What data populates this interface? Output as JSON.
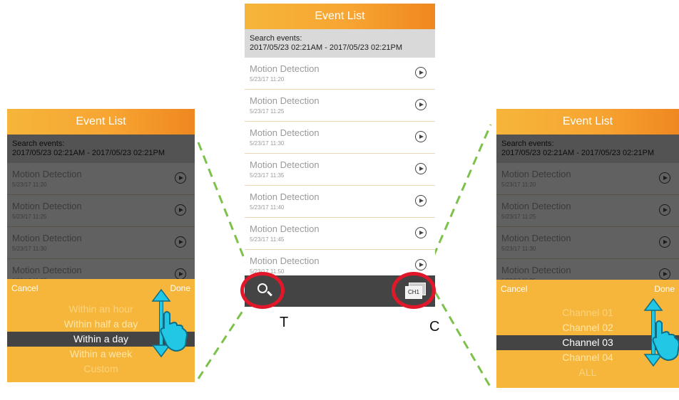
{
  "app_title": "Event List",
  "search": {
    "label": "Search events:",
    "range": "2017/05/23 02:21AM - 2017/05/23 02:21PM"
  },
  "events": [
    {
      "title": "Motion Detection",
      "time": "5/23/17 11:20"
    },
    {
      "title": "Motion Detection",
      "time": "5/23/17 11:25"
    },
    {
      "title": "Motion Detection",
      "time": "5/23/17 11:30"
    },
    {
      "title": "Motion Detection",
      "time": "5/23/17 11:35"
    },
    {
      "title": "Motion Detection",
      "time": "5/23/17 11:40"
    },
    {
      "title": "Motion Detection",
      "time": "5/23/17 11:45"
    },
    {
      "title": "Motion Detection",
      "time": "5/23/17 11:50"
    }
  ],
  "toolbar": {
    "search_icon": "search-icon",
    "channel_badge": "CH1"
  },
  "time_picker": {
    "cancel": "Cancel",
    "done": "Done",
    "options": [
      "Within an hour",
      "Within half a day",
      "Within a day",
      "Within a week",
      "Custom"
    ],
    "selected_index": 2
  },
  "channel_picker": {
    "cancel": "Cancel",
    "done": "Done",
    "options": [
      "Channel 01",
      "Channel 02",
      "Channel 03",
      "Channel 04",
      "ALL"
    ],
    "selected_index": 2
  },
  "callouts": {
    "search": "T",
    "channel": "C"
  },
  "colors": {
    "accent": "#f6b53b",
    "dark_bar": "#444444",
    "highlight": "#e0182a",
    "guide": "#7cc24a",
    "gesture": "#22c7e6"
  }
}
